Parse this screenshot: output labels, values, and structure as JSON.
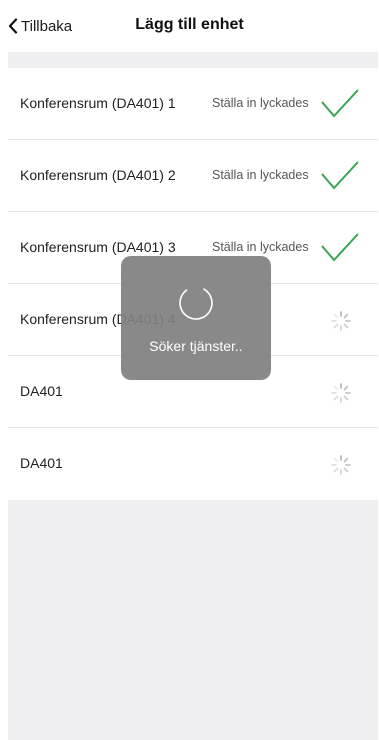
{
  "nav": {
    "back_label": "Tillbaka",
    "title": "Lägg till enhet"
  },
  "devices": [
    {
      "name": "Konferensrum (DA401) 1",
      "status": "Ställa in lyckades",
      "state": "success"
    },
    {
      "name": "Konferensrum (DA401) 2",
      "status": "Ställa in lyckades",
      "state": "success"
    },
    {
      "name": "Konferensrum (DA401) 3",
      "status": "Ställa in lyckades",
      "state": "success"
    },
    {
      "name": "Konferensrum (DA401) 4",
      "status": "",
      "state": "loading"
    },
    {
      "name": "DA401",
      "status": "",
      "state": "loading"
    },
    {
      "name": "DA401",
      "status": "",
      "state": "loading"
    }
  ],
  "hud": {
    "message": "Söker tjänster.."
  },
  "icons": {
    "back": "chevron-left-icon",
    "success": "checkmark-icon",
    "loading": "activity-spinner-icon",
    "hud_spinner": "loading-ring-icon"
  },
  "colors": {
    "success": "#34a853",
    "background": "#efeff1",
    "hud": "#808080"
  }
}
